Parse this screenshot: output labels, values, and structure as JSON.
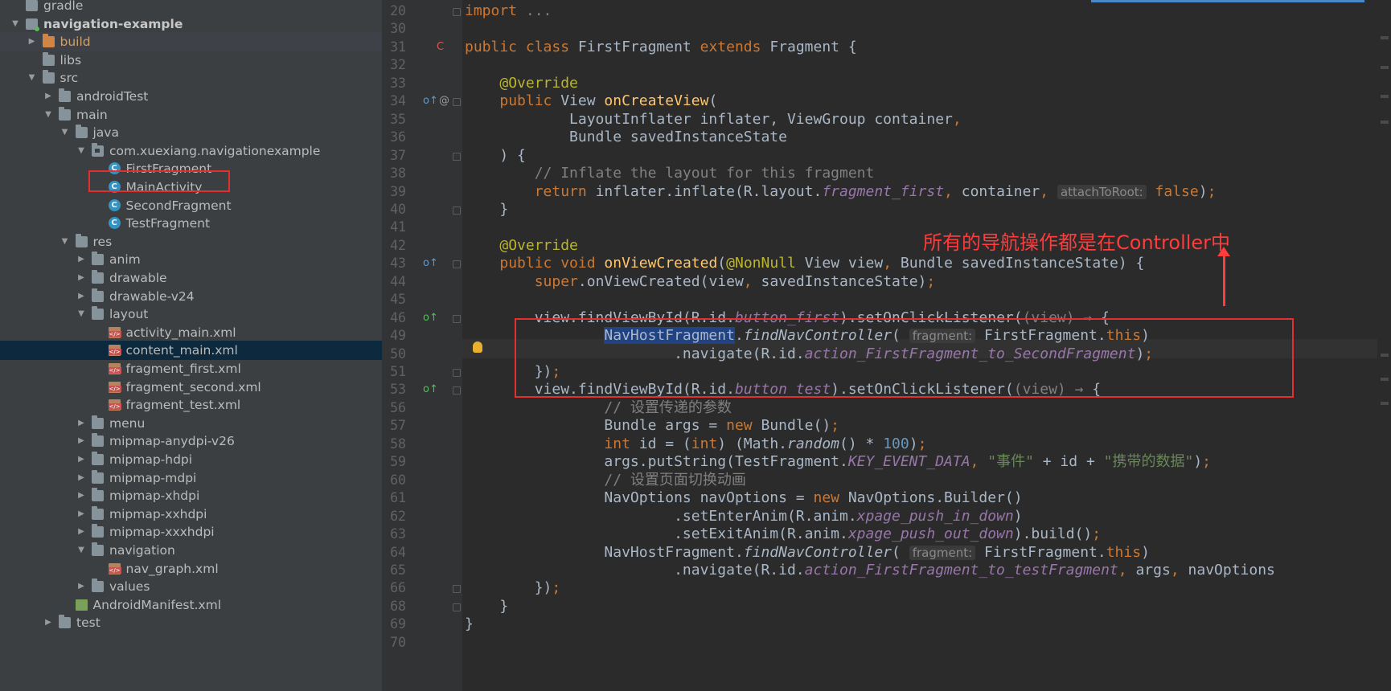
{
  "tree": {
    "rows": [
      {
        "label": "gradle",
        "icon": "folder-icon",
        "arrow": "",
        "indent": 0
      },
      {
        "label": "navigation-example",
        "icon": "module-icon",
        "arrow": "expanded",
        "indent": 0,
        "bold": true
      },
      {
        "label": "build",
        "icon": "folder-orange-icon",
        "arrow": "collapsed",
        "indent": 1,
        "orange": true,
        "hl": true
      },
      {
        "label": "libs",
        "icon": "folder-icon",
        "arrow": "",
        "indent": 1
      },
      {
        "label": "src",
        "icon": "folder-icon",
        "arrow": "expanded",
        "indent": 1
      },
      {
        "label": "androidTest",
        "icon": "folder-icon",
        "arrow": "collapsed",
        "indent": 2
      },
      {
        "label": "main",
        "icon": "folder-icon",
        "arrow": "expanded",
        "indent": 2
      },
      {
        "label": "java",
        "icon": "folder-icon",
        "arrow": "expanded",
        "indent": 3
      },
      {
        "label": "com.xuexiang.navigationexample",
        "icon": "package-icon",
        "arrow": "expanded",
        "indent": 4
      },
      {
        "label": "FirstFragment",
        "icon": "class-icon",
        "arrow": "",
        "indent": 5
      },
      {
        "label": "MainActivity",
        "icon": "class-icon",
        "arrow": "",
        "indent": 5
      },
      {
        "label": "SecondFragment",
        "icon": "class-icon",
        "arrow": "",
        "indent": 5
      },
      {
        "label": "TestFragment",
        "icon": "class-icon",
        "arrow": "",
        "indent": 5
      },
      {
        "label": "res",
        "icon": "folder-icon",
        "arrow": "expanded",
        "indent": 3
      },
      {
        "label": "anim",
        "icon": "folder-icon",
        "arrow": "collapsed",
        "indent": 4
      },
      {
        "label": "drawable",
        "icon": "folder-icon",
        "arrow": "collapsed",
        "indent": 4
      },
      {
        "label": "drawable-v24",
        "icon": "folder-icon",
        "arrow": "collapsed",
        "indent": 4
      },
      {
        "label": "layout",
        "icon": "folder-icon",
        "arrow": "expanded",
        "indent": 4
      },
      {
        "label": "activity_main.xml",
        "icon": "xml-file-icon",
        "arrow": "",
        "indent": 5
      },
      {
        "label": "content_main.xml",
        "icon": "xml-file-icon",
        "arrow": "",
        "indent": 5,
        "selected": true
      },
      {
        "label": "fragment_first.xml",
        "icon": "xml-file-icon",
        "arrow": "",
        "indent": 5
      },
      {
        "label": "fragment_second.xml",
        "icon": "xml-file-icon",
        "arrow": "",
        "indent": 5
      },
      {
        "label": "fragment_test.xml",
        "icon": "xml-file-icon",
        "arrow": "",
        "indent": 5
      },
      {
        "label": "menu",
        "icon": "folder-icon",
        "arrow": "collapsed",
        "indent": 4
      },
      {
        "label": "mipmap-anydpi-v26",
        "icon": "folder-icon",
        "arrow": "collapsed",
        "indent": 4
      },
      {
        "label": "mipmap-hdpi",
        "icon": "folder-icon",
        "arrow": "collapsed",
        "indent": 4
      },
      {
        "label": "mipmap-mdpi",
        "icon": "folder-icon",
        "arrow": "collapsed",
        "indent": 4
      },
      {
        "label": "mipmap-xhdpi",
        "icon": "folder-icon",
        "arrow": "collapsed",
        "indent": 4
      },
      {
        "label": "mipmap-xxhdpi",
        "icon": "folder-icon",
        "arrow": "collapsed",
        "indent": 4
      },
      {
        "label": "mipmap-xxxhdpi",
        "icon": "folder-icon",
        "arrow": "collapsed",
        "indent": 4
      },
      {
        "label": "navigation",
        "icon": "folder-icon",
        "arrow": "expanded",
        "indent": 4
      },
      {
        "label": "nav_graph.xml",
        "icon": "xml-file-icon",
        "arrow": "",
        "indent": 5
      },
      {
        "label": "values",
        "icon": "folder-icon",
        "arrow": "collapsed",
        "indent": 4
      },
      {
        "label": "AndroidManifest.xml",
        "icon": "manifest-file-icon",
        "arrow": "",
        "indent": 3
      },
      {
        "label": "test",
        "icon": "folder-icon",
        "arrow": "collapsed",
        "indent": 2
      }
    ]
  },
  "editor": {
    "lines": [
      {
        "num": "20",
        "tokens": [
          [
            "kw",
            "import "
          ],
          [
            "cm",
            "..."
          ]
        ]
      },
      {
        "num": "30",
        "tokens": []
      },
      {
        "num": "31",
        "tokens": [
          [
            "kw",
            "public class "
          ],
          [
            "tx",
            "FirstFragment "
          ],
          [
            "kw",
            "extends "
          ],
          [
            "tx",
            "Fragment {"
          ]
        ]
      },
      {
        "num": "32",
        "tokens": []
      },
      {
        "num": "33",
        "tokens": [
          [
            "tx",
            "    "
          ],
          [
            "an",
            "@Override"
          ]
        ]
      },
      {
        "num": "34",
        "tokens": [
          [
            "tx",
            "    "
          ],
          [
            "kw",
            "public "
          ],
          [
            "tx",
            "View "
          ],
          [
            "fn",
            "onCreateView"
          ],
          [
            "tx",
            "("
          ]
        ]
      },
      {
        "num": "35",
        "tokens": [
          [
            "tx",
            "            LayoutInflater inflater, ViewGroup container"
          ],
          [
            "kw",
            ","
          ]
        ]
      },
      {
        "num": "36",
        "tokens": [
          [
            "tx",
            "            Bundle savedInstanceState"
          ]
        ]
      },
      {
        "num": "37",
        "tokens": [
          [
            "tx",
            "    ) {"
          ]
        ]
      },
      {
        "num": "38",
        "tokens": [
          [
            "tx",
            "        "
          ],
          [
            "cm",
            "// Inflate the layout for this fragment"
          ]
        ]
      },
      {
        "num": "39",
        "tokens": [
          [
            "tx",
            "        "
          ],
          [
            "kw",
            "return "
          ],
          [
            "tx",
            "inflater.inflate(R.layout."
          ],
          [
            "it",
            "fragment_first"
          ],
          [
            "kw",
            ", "
          ],
          [
            "tx",
            "container"
          ],
          [
            "kw",
            ", "
          ],
          [
            "hint",
            "attachToRoot:"
          ],
          [
            "kw",
            " false"
          ],
          [
            "tx",
            ")"
          ],
          [
            "kw",
            ";"
          ]
        ]
      },
      {
        "num": "40",
        "tokens": [
          [
            "tx",
            "    }"
          ]
        ]
      },
      {
        "num": "41",
        "tokens": []
      },
      {
        "num": "42",
        "tokens": [
          [
            "tx",
            "    "
          ],
          [
            "an",
            "@Override"
          ]
        ]
      },
      {
        "num": "43",
        "tokens": [
          [
            "tx",
            "    "
          ],
          [
            "kw",
            "public void "
          ],
          [
            "fn",
            "onViewCreated"
          ],
          [
            "tx",
            "("
          ],
          [
            "an",
            "@NonNull "
          ],
          [
            "tx",
            "View view"
          ],
          [
            "kw",
            ", "
          ],
          [
            "tx",
            "Bundle savedInstanceState) {"
          ]
        ]
      },
      {
        "num": "44",
        "tokens": [
          [
            "tx",
            "        "
          ],
          [
            "kw",
            "super"
          ],
          [
            "tx",
            ".onViewCreated(view"
          ],
          [
            "kw",
            ", "
          ],
          [
            "tx",
            "savedInstanceState)"
          ],
          [
            "kw",
            ";"
          ]
        ]
      },
      {
        "num": "45",
        "tokens": []
      },
      {
        "num": "46",
        "tokens": [
          [
            "tx",
            "        view.findViewById(R.id."
          ],
          [
            "it",
            "button_first"
          ],
          [
            "tx",
            ").setOnClickListener("
          ],
          [
            "cm",
            "(view) → "
          ],
          [
            "tx",
            "{"
          ]
        ]
      },
      {
        "num": "49",
        "tokens": [
          [
            "tx",
            "                "
          ],
          [
            "sel",
            "NavHostFragment"
          ],
          [
            "tx",
            "."
          ],
          [
            "itm",
            "findNavController"
          ],
          [
            "tx",
            "( "
          ],
          [
            "hint",
            "fragment:"
          ],
          [
            "tx",
            " FirstFragment."
          ],
          [
            "kw",
            "this"
          ],
          [
            "tx",
            ")"
          ]
        ]
      },
      {
        "num": "50",
        "tokens": [
          [
            "tx",
            "                        .navigate(R.id."
          ],
          [
            "it",
            "action_FirstFragment_to_SecondFragment"
          ],
          [
            "tx",
            ")"
          ],
          [
            "kw",
            ";"
          ]
        ]
      },
      {
        "num": "51",
        "tokens": [
          [
            "tx",
            "        })"
          ],
          [
            "kw",
            ";"
          ]
        ]
      },
      {
        "num": "53",
        "tokens": [
          [
            "tx",
            "        view.findViewById(R.id."
          ],
          [
            "it",
            "button_test"
          ],
          [
            "tx",
            ").setOnClickListener("
          ],
          [
            "cm",
            "(view) → "
          ],
          [
            "tx",
            "{"
          ]
        ]
      },
      {
        "num": "56",
        "tokens": [
          [
            "tx",
            "                "
          ],
          [
            "cm",
            "// 设置传递的参数"
          ]
        ]
      },
      {
        "num": "57",
        "tokens": [
          [
            "tx",
            "                Bundle args = "
          ],
          [
            "kw",
            "new "
          ],
          [
            "tx",
            "Bundle()"
          ],
          [
            "kw",
            ";"
          ]
        ]
      },
      {
        "num": "58",
        "tokens": [
          [
            "tx",
            "                "
          ],
          [
            "kw",
            "int "
          ],
          [
            "tx",
            "id = ("
          ],
          [
            "kw",
            "int"
          ],
          [
            "tx",
            ") (Math."
          ],
          [
            "itm",
            "random"
          ],
          [
            "tx",
            "() * "
          ],
          [
            "nm",
            "100"
          ],
          [
            "tx",
            ")"
          ],
          [
            "kw",
            ";"
          ]
        ]
      },
      {
        "num": "59",
        "tokens": [
          [
            "tx",
            "                args.putString(TestFragment."
          ],
          [
            "it",
            "KEY_EVENT_DATA"
          ],
          [
            "kw",
            ", "
          ],
          [
            "st",
            "\"事件\""
          ],
          [
            "tx",
            " + id + "
          ],
          [
            "st",
            "\"携带的数据\""
          ],
          [
            "tx",
            ")"
          ],
          [
            "kw",
            ";"
          ]
        ]
      },
      {
        "num": "60",
        "tokens": [
          [
            "tx",
            "                "
          ],
          [
            "cm",
            "// 设置页面切换动画"
          ]
        ]
      },
      {
        "num": "61",
        "tokens": [
          [
            "tx",
            "                NavOptions navOptions = "
          ],
          [
            "kw",
            "new "
          ],
          [
            "tx",
            "NavOptions.Builder()"
          ]
        ]
      },
      {
        "num": "62",
        "tokens": [
          [
            "tx",
            "                        .setEnterAnim(R.anim."
          ],
          [
            "it",
            "xpage_push_in_down"
          ],
          [
            "tx",
            ")"
          ]
        ]
      },
      {
        "num": "63",
        "tokens": [
          [
            "tx",
            "                        .setExitAnim(R.anim."
          ],
          [
            "it",
            "xpage_push_out_down"
          ],
          [
            "tx",
            ").build()"
          ],
          [
            "kw",
            ";"
          ]
        ]
      },
      {
        "num": "64",
        "tokens": [
          [
            "tx",
            "                NavHostFragment."
          ],
          [
            "itm",
            "findNavController"
          ],
          [
            "tx",
            "( "
          ],
          [
            "hint",
            "fragment:"
          ],
          [
            "tx",
            " FirstFragment."
          ],
          [
            "kw",
            "this"
          ],
          [
            "tx",
            ")"
          ]
        ]
      },
      {
        "num": "65",
        "tokens": [
          [
            "tx",
            "                        .navigate(R.id."
          ],
          [
            "it",
            "action_FirstFragment_to_testFragment"
          ],
          [
            "kw",
            ", "
          ],
          [
            "tx",
            "args"
          ],
          [
            "kw",
            ", "
          ],
          [
            "tx",
            "navOptions"
          ]
        ]
      },
      {
        "num": "66",
        "tokens": [
          [
            "tx",
            "        })"
          ],
          [
            "kw",
            ";"
          ]
        ]
      },
      {
        "num": "68",
        "tokens": [
          [
            "tx",
            "    }"
          ]
        ]
      },
      {
        "num": "69",
        "tokens": [
          [
            "tx",
            "}"
          ]
        ]
      },
      {
        "num": "70",
        "tokens": []
      }
    ],
    "gutter_marks": [
      {
        "line": "31",
        "icon": "class-icon",
        "text": "C"
      },
      {
        "line": "34",
        "icon": "override-up-icon",
        "text": "o↑"
      },
      {
        "line": "34b",
        "icon": "at-icon",
        "text": "@"
      },
      {
        "line": "43",
        "icon": "override-up-icon",
        "text": "o↑"
      },
      {
        "line": "46",
        "icon": "implement-icon",
        "text": "o↑"
      },
      {
        "line": "53",
        "icon": "implement-icon",
        "text": "o↑"
      }
    ]
  },
  "annotation": {
    "text": "所有的导航操作都是在Controller中"
  },
  "colors": {
    "redbox": "#e03030",
    "annotation": "#ff3b3b",
    "keyword": "#cc7832",
    "background": "#2b2b2b"
  }
}
